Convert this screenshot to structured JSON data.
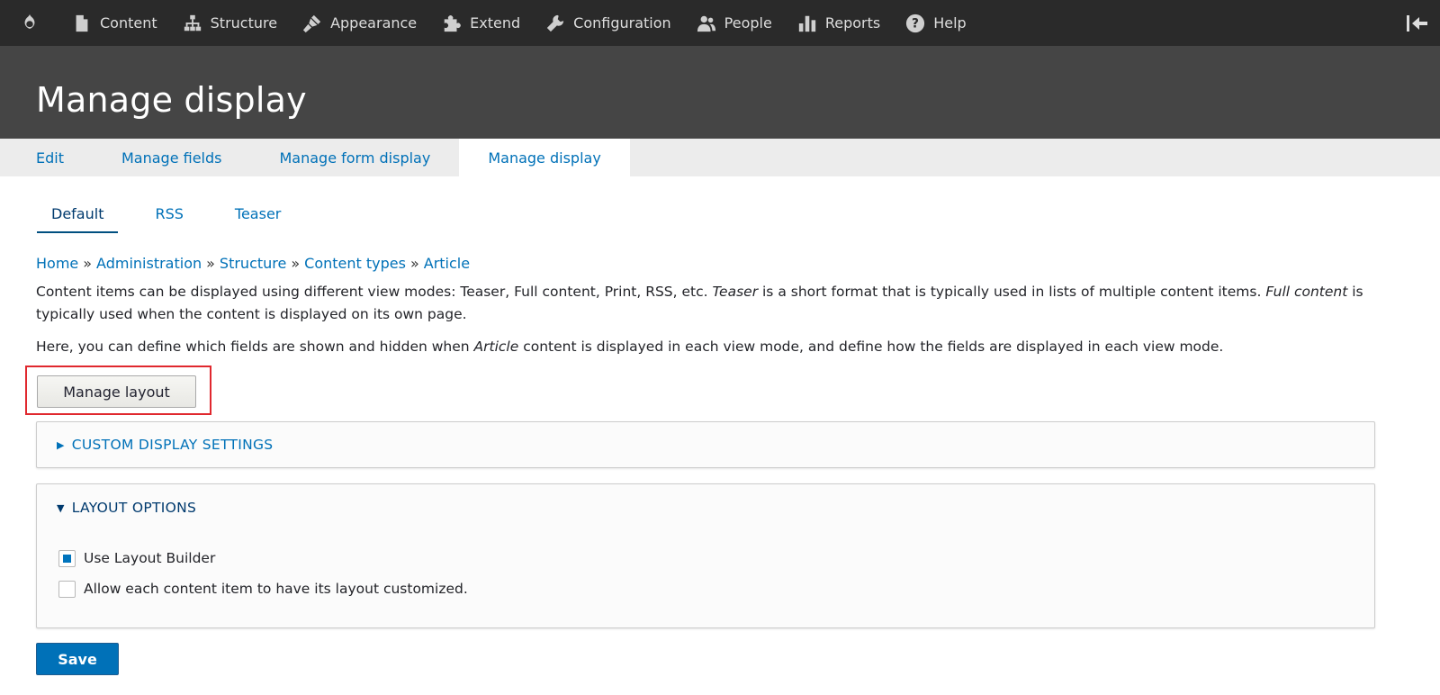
{
  "toolbar": {
    "items": [
      {
        "label": "Content",
        "icon": "file-icon"
      },
      {
        "label": "Structure",
        "icon": "sitemap-icon"
      },
      {
        "label": "Appearance",
        "icon": "paintbrush-icon"
      },
      {
        "label": "Extend",
        "icon": "puzzle-icon"
      },
      {
        "label": "Configuration",
        "icon": "wrench-icon"
      },
      {
        "label": "People",
        "icon": "people-icon"
      },
      {
        "label": "Reports",
        "icon": "bar-chart-icon"
      },
      {
        "label": "Help",
        "icon": "help-icon"
      }
    ]
  },
  "header": {
    "title": "Manage display"
  },
  "primary_tabs": [
    {
      "label": "Edit",
      "active": false
    },
    {
      "label": "Manage fields",
      "active": false
    },
    {
      "label": "Manage form display",
      "active": false
    },
    {
      "label": "Manage display",
      "active": true
    }
  ],
  "secondary_tabs": [
    {
      "label": "Default",
      "active": true
    },
    {
      "label": "RSS",
      "active": false
    },
    {
      "label": "Teaser",
      "active": false
    }
  ],
  "breadcrumb": [
    {
      "label": "Home"
    },
    {
      "label": "Administration"
    },
    {
      "label": "Structure"
    },
    {
      "label": "Content types"
    },
    {
      "label": "Article"
    }
  ],
  "description": {
    "p1_part1": "Content items can be displayed using different view modes: Teaser, Full content, Print, RSS, etc. ",
    "p1_em1": "Teaser",
    "p1_part2": " is a short format that is typically used in lists of multiple content items. ",
    "p1_em2": "Full content",
    "p1_part3": " is typically used when the content is displayed on its own page.",
    "p2_part1": "Here, you can define which fields are shown and hidden when ",
    "p2_em": "Article",
    "p2_part2": " content is displayed in each view mode, and define how the fields are displayed in each view mode."
  },
  "manage_layout_label": "Manage layout",
  "custom_display": {
    "label": "CUSTOM DISPLAY SETTINGS",
    "expanded": false
  },
  "layout_options": {
    "label": "LAYOUT OPTIONS",
    "expanded": true,
    "use_layout_builder": {
      "label": "Use Layout Builder",
      "checked": true
    },
    "allow_custom": {
      "label": "Allow each content item to have its layout customized.",
      "checked": false
    }
  },
  "save_label": "Save",
  "colors": {
    "link": "#0071b8",
    "toolbar_bg": "#2a2a2a",
    "header_bg": "#454545",
    "highlight_border": "#e0282e"
  }
}
